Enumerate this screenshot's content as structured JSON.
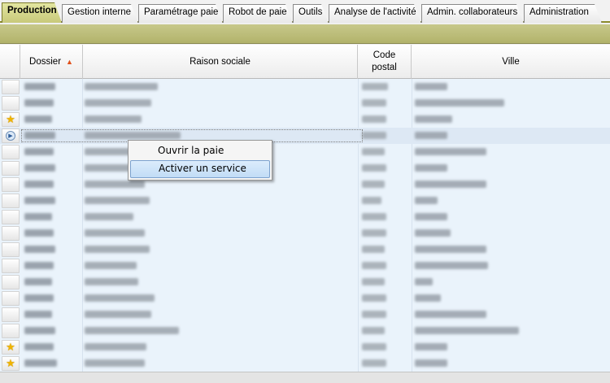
{
  "tabs": [
    {
      "label": "Production",
      "active": true
    },
    {
      "label": "Gestion interne",
      "active": false
    },
    {
      "label": "Paramétrage paie",
      "active": false
    },
    {
      "label": "Robot de paie",
      "active": false
    },
    {
      "label": "Outils",
      "active": false
    },
    {
      "label": "Analyse de l'activité",
      "active": false
    },
    {
      "label": "Admin. collaborateurs",
      "active": false
    },
    {
      "label": "Administration",
      "active": false
    }
  ],
  "colors": {
    "accent": "#b2b36b",
    "active_tab": "#d4d68a",
    "star": "#f0b400",
    "grid_bg": "#eaf3fb"
  },
  "grid": {
    "columns": {
      "dossier": "Dossier",
      "raison_sociale": "Raison sociale",
      "code_postal_line1": "Code",
      "code_postal_line2": "postal",
      "ville": "Ville"
    },
    "sort": {
      "column": "Dossier",
      "direction": "ascending",
      "icon": "triangle-up-icon"
    },
    "rows": [
      {
        "marker": "none"
      },
      {
        "marker": "none"
      },
      {
        "marker": "star"
      },
      {
        "marker": "current"
      },
      {
        "marker": "none"
      },
      {
        "marker": "none"
      },
      {
        "marker": "none"
      },
      {
        "marker": "none"
      },
      {
        "marker": "none"
      },
      {
        "marker": "none"
      },
      {
        "marker": "none"
      },
      {
        "marker": "none"
      },
      {
        "marker": "none"
      },
      {
        "marker": "none"
      },
      {
        "marker": "none"
      },
      {
        "marker": "none"
      },
      {
        "marker": "star"
      },
      {
        "marker": "star"
      }
    ],
    "content_note": "cell values blurred / not readable"
  },
  "context_menu": {
    "items": [
      {
        "label": "Ouvrir la paie",
        "highlighted": false
      },
      {
        "label": "Activer un service",
        "highlighted": true
      }
    ]
  }
}
